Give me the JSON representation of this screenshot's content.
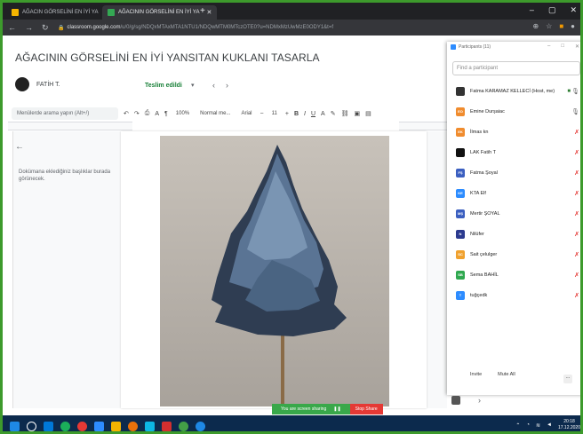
{
  "browser": {
    "tabs": [
      {
        "label": "AĞACIN GÖRSELİNİ EN İYİ YA",
        "active": false
      },
      {
        "label": "AĞACININ GÖRSELİNİ EN İYİ YA",
        "active": true
      }
    ],
    "new_tab": "+",
    "url_host": "classroom.google.com",
    "url_path": "/u/0/g/sg/NDQxMTAxMTA1NTU1/NDQwMTM0MTczOTE0?u=NDMxMzUwMzE0ODY1&t=f"
  },
  "document": {
    "title": "AĞACININ GÖRSELİNİ EN İYİ YANSITAN KUKLANI TASARLA",
    "student_name": "FATİH T.",
    "status": "Teslim edildi",
    "prev": "‹",
    "next": "›"
  },
  "toolbar": {
    "menu_search_placeholder": "Menülerde arama yapın (Alt+/)",
    "zoom": "100%",
    "style": "Normal me...",
    "font": "Arial",
    "size": "11"
  },
  "outline": {
    "back": "←",
    "hint": "Dokümana eklediğiniz başlıklar burada görünecek."
  },
  "zoom_panel": {
    "title": "Participants (11)",
    "search_placeholder": "Find a participant",
    "participants": [
      {
        "initials": "",
        "name": "Fatma KARAMAZ KELLECİ (Host, me)",
        "color": "#333333",
        "mic": "on",
        "video": true
      },
      {
        "initials": "EO",
        "name": "Emine Durşaiac",
        "color": "#f08c2e",
        "mic": "on",
        "video": false
      },
      {
        "initials": "EK",
        "name": "İlmas kn",
        "color": "#f08c2e",
        "mic": "muted",
        "video": false
      },
      {
        "initials": "",
        "name": "LAK Fatih T",
        "color": "#111111",
        "mic": "muted",
        "video": false
      },
      {
        "initials": "FŞ",
        "name": "Fatma Şoyal",
        "color": "#3b5fc0",
        "mic": "muted",
        "video": false
      },
      {
        "initials": "KE",
        "name": "KTA Elf",
        "color": "#2d8cff",
        "mic": "muted",
        "video": false
      },
      {
        "initials": "MŞ",
        "name": "Mertir ŞOYAL",
        "color": "#3b5fc0",
        "mic": "muted",
        "video": false
      },
      {
        "initials": "N",
        "name": "Nilüfer",
        "color": "#2b3a8f",
        "mic": "muted",
        "video": false
      },
      {
        "initials": "SC",
        "name": "Sait çelulger",
        "color": "#f0a12e",
        "mic": "muted",
        "video": false
      },
      {
        "initials": "SB",
        "name": "Sema BAHİL",
        "color": "#2fa84f",
        "mic": "muted",
        "video": false
      },
      {
        "initials": "T",
        "name": "tuğçedk",
        "color": "#2d8cff",
        "mic": "muted",
        "video": false
      }
    ],
    "invite": "Invite",
    "mute_all": "Mute All",
    "more": "..."
  },
  "sharing": {
    "message": "You are screen sharing",
    "stop": "Stop Share"
  },
  "taskbar": {
    "time": "20:18",
    "date": "17.12.2020"
  }
}
